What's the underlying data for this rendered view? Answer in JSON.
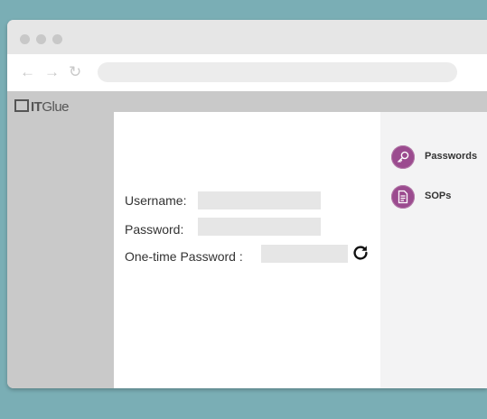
{
  "app": {
    "logo_text_it": "IT",
    "logo_text_glue": "Glue"
  },
  "browser": {
    "nav_back": "←",
    "nav_forward": "→",
    "nav_reload": "↻",
    "url": ""
  },
  "login": {
    "username_label": "Username:",
    "username_value": "",
    "password_label": "Password:",
    "password_value": "",
    "otp_label": "One-time Password :",
    "otp_value": ""
  },
  "sidebar": {
    "items": [
      {
        "label": "Passwords",
        "icon": "key-icon"
      },
      {
        "label": "SOPs",
        "icon": "document-icon"
      }
    ]
  },
  "colors": {
    "background": "#7aaeb5",
    "accent": "#9b4b8f"
  }
}
